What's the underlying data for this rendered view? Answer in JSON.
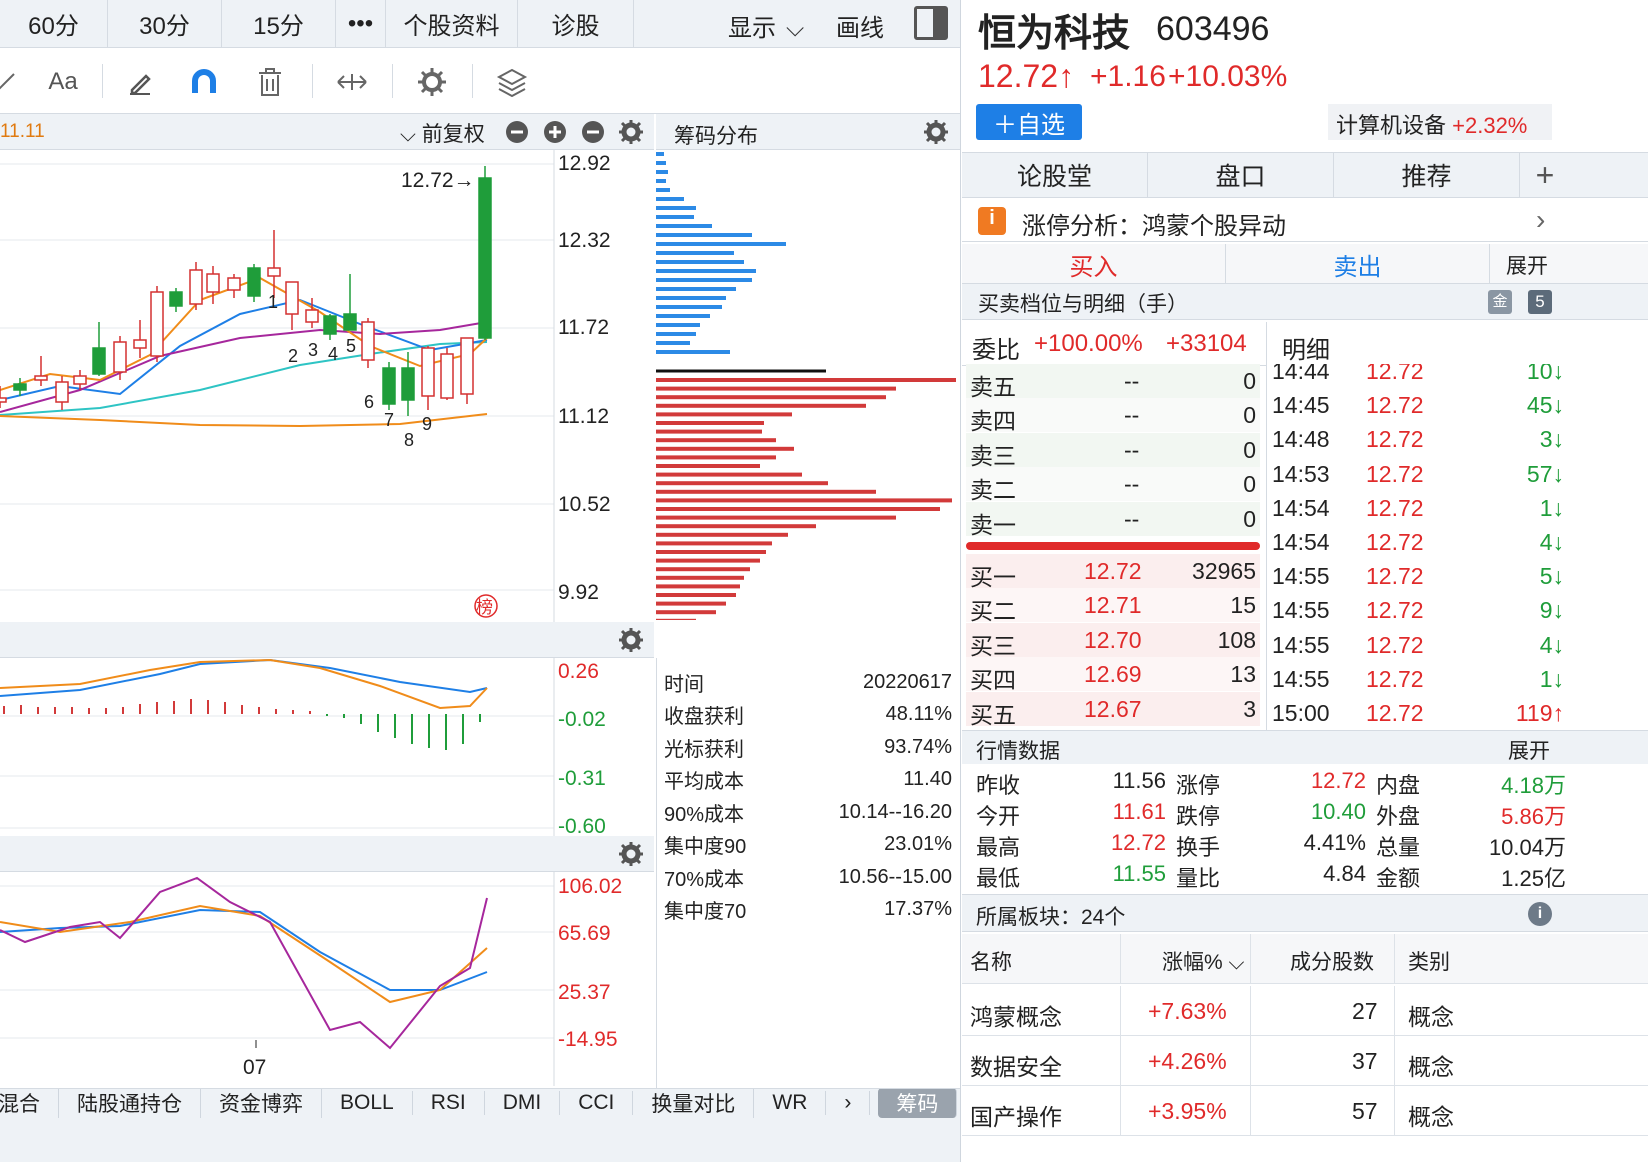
{
  "top_tabs": [
    "60分",
    "30分",
    "15分",
    "•••",
    "个股资料",
    "诊股"
  ],
  "top_right": {
    "display": "显示",
    "draw": "画线"
  },
  "toolbar": {
    "font_label": "Aa"
  },
  "kline": {
    "date_label": "11.11",
    "adjust": "前复权",
    "price_tag": "12.72→",
    "y_ticks": [
      "12.92",
      "12.32",
      "11.72",
      "11.12",
      "10.52",
      "9.92"
    ],
    "wave_labels": [
      "1",
      "2",
      "3",
      "4",
      "5",
      "6",
      "7",
      "8",
      "9"
    ],
    "rank_badge": "榜"
  },
  "chip": {
    "title": "筹码分布",
    "rows": [
      {
        "label": "时间",
        "value": "20220617"
      },
      {
        "label": "收盘获利",
        "value": "48.11%"
      },
      {
        "label": "光标获利",
        "value": "93.74%"
      },
      {
        "label": "平均成本",
        "value": "11.40"
      },
      {
        "label": "90%成本",
        "value": "10.14--16.20"
      },
      {
        "label": "集中度90",
        "value": "23.01%"
      },
      {
        "label": "70%成本",
        "value": "10.56--15.00"
      },
      {
        "label": "集中度70",
        "value": "17.37%"
      }
    ]
  },
  "macd": {
    "y_ticks": [
      "0.26",
      "-0.02",
      "-0.31",
      "-0.60"
    ]
  },
  "kdj": {
    "y_ticks": [
      "106.02",
      "65.69",
      "25.37",
      "-14.95"
    ],
    "x_label": "07"
  },
  "bottom_tabs": [
    "混合",
    "陆股通持仓",
    "资金博弈",
    "BOLL",
    "RSI",
    "DMI",
    "CCI",
    "换量对比",
    "WR",
    "›",
    "筹码"
  ],
  "stock": {
    "name": "恒为科技",
    "code": "603496",
    "price": "12.72↑",
    "change": "+1.16",
    "change_pct": "+10.03%",
    "watch_btn": "＋自选",
    "sector": "计算机设备",
    "sector_pct": "+2.32%"
  },
  "panel_tabs": [
    "论股堂",
    "盘口",
    "推荐",
    "+"
  ],
  "analysis": {
    "icon": "i",
    "text": "涨停分析：鸿蒙个股异动",
    "arrow": "›"
  },
  "trade": {
    "buy": "买入",
    "sell": "卖出",
    "expand": "展开"
  },
  "orderbook": {
    "title": "买卖档位与明细（手）",
    "badge": "5",
    "ratio_label": "委比",
    "ratio_pct": "+100.00%",
    "ratio_num": "+33104",
    "detail_label": "明细",
    "asks": [
      {
        "l": "卖五",
        "p": "--",
        "v": "0"
      },
      {
        "l": "卖四",
        "p": "--",
        "v": "0"
      },
      {
        "l": "卖三",
        "p": "--",
        "v": "0"
      },
      {
        "l": "卖二",
        "p": "--",
        "v": "0"
      },
      {
        "l": "卖一",
        "p": "--",
        "v": "0"
      }
    ],
    "bids": [
      {
        "l": "买一",
        "p": "12.72",
        "v": "32965"
      },
      {
        "l": "买二",
        "p": "12.71",
        "v": "15"
      },
      {
        "l": "买三",
        "p": "12.70",
        "v": "108"
      },
      {
        "l": "买四",
        "p": "12.69",
        "v": "13"
      },
      {
        "l": "买五",
        "p": "12.67",
        "v": "3"
      }
    ]
  },
  "ticks": [
    {
      "t": "14:44",
      "p": "12.72",
      "v": "10↓"
    },
    {
      "t": "14:45",
      "p": "12.72",
      "v": "45↓"
    },
    {
      "t": "14:48",
      "p": "12.72",
      "v": "3↓"
    },
    {
      "t": "14:53",
      "p": "12.72",
      "v": "57↓"
    },
    {
      "t": "14:54",
      "p": "12.72",
      "v": "1↓"
    },
    {
      "t": "14:54",
      "p": "12.72",
      "v": "4↓"
    },
    {
      "t": "14:55",
      "p": "12.72",
      "v": "5↓"
    },
    {
      "t": "14:55",
      "p": "12.72",
      "v": "9↓"
    },
    {
      "t": "14:55",
      "p": "12.72",
      "v": "4↓"
    },
    {
      "t": "14:55",
      "p": "12.72",
      "v": "1↓"
    },
    {
      "t": "15:00",
      "p": "12.72",
      "v": "119↑"
    }
  ],
  "market": {
    "title": "行情数据",
    "expand": "展开",
    "rows": [
      [
        "昨收",
        "11.56",
        "涨停",
        "12.72",
        "内盘",
        "4.18万"
      ],
      [
        "今开",
        "11.61",
        "跌停",
        "10.40",
        "外盘",
        "5.86万"
      ],
      [
        "最高",
        "12.72",
        "换手",
        "4.41%",
        "总量",
        "10.04万"
      ],
      [
        "最低",
        "11.55",
        "量比",
        "4.84",
        "金额",
        "1.25亿"
      ]
    ]
  },
  "boards": {
    "title": "所属板块：24个",
    "headers": [
      "名称",
      "涨幅%",
      "成分股数",
      "类别"
    ],
    "rows": [
      {
        "name": "鸿蒙概念",
        "pct": "+7.63%",
        "n": "27",
        "type": "概念"
      },
      {
        "name": "数据安全",
        "pct": "+4.26%",
        "n": "37",
        "type": "概念"
      },
      {
        "name": "国产操作",
        "pct": "+3.95%",
        "n": "57",
        "type": "概念"
      }
    ]
  },
  "colors": {
    "up": "#e02a2a",
    "down": "#1f9d3a",
    "accent": "#1e7fe6"
  }
}
